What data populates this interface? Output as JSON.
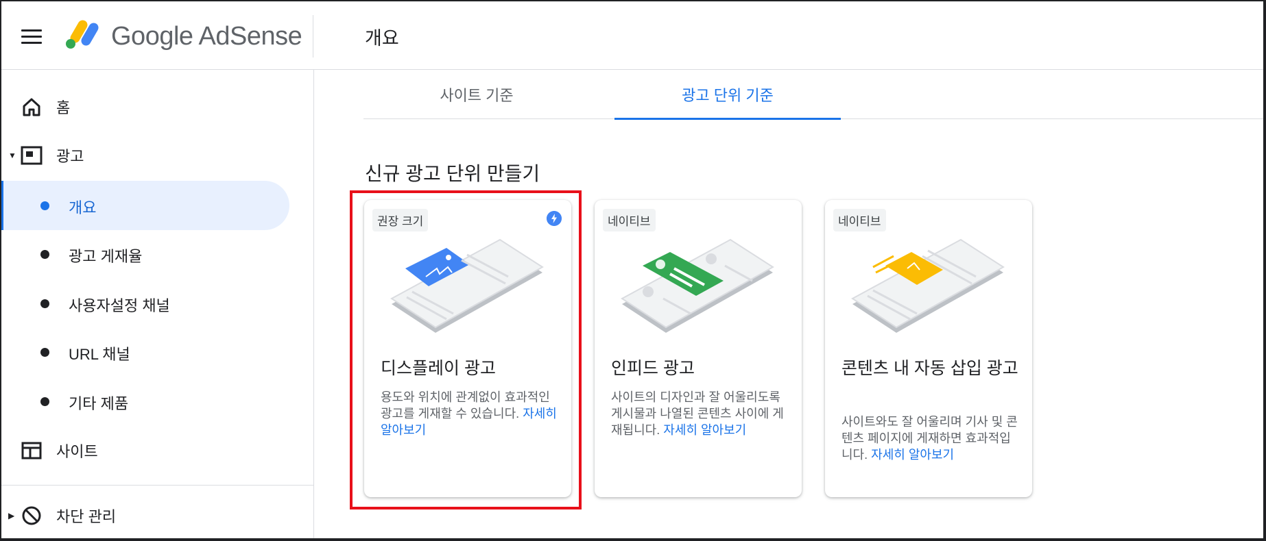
{
  "app": {
    "logo_text": "Google AdSense",
    "page_title": "개요"
  },
  "sidebar": {
    "items": [
      {
        "label": "홈",
        "icon": "home-icon"
      },
      {
        "label": "광고",
        "icon": "ad-unit-icon",
        "expanded": true
      },
      {
        "label": "사이트",
        "icon": "sites-icon"
      },
      {
        "label": "차단 관리",
        "icon": "block-icon",
        "expanded": false
      }
    ],
    "ads_subitems": [
      {
        "label": "개요",
        "active": true
      },
      {
        "label": "광고 게재율",
        "active": false
      },
      {
        "label": "사용자설정 채널",
        "active": false
      },
      {
        "label": "URL 채널",
        "active": false
      },
      {
        "label": "기타 제품",
        "active": false
      }
    ]
  },
  "tabs": [
    {
      "label": "사이트 기준",
      "selected": false
    },
    {
      "label": "광고 단위 기준",
      "selected": true
    }
  ],
  "section_title": "신규 광고 단위 만들기",
  "cards": [
    {
      "chip": "권장 크기",
      "badge_icon": "bolt-icon",
      "title": "디스플레이 광고",
      "description": "용도와 위치에 관계없이 효과적인 광고를 게재할 수 있습니다.",
      "link": "자세히 알아보기",
      "accent": "#4285f4"
    },
    {
      "chip": "네이티브",
      "title": "인피드 광고",
      "description": "사이트의 디자인과 잘 어울리도록 게시물과 나열된 콘텐츠 사이에 게재됩니다.",
      "link": "자세히 알아보기",
      "accent": "#34a853"
    },
    {
      "chip": "네이티브",
      "title": "콘텐츠 내 자동 삽입 광고",
      "description": "사이트와도 잘 어울리며 기사 및 콘텐츠 페이지에 게재하면 효과적입니다.",
      "link": "자세히 알아보기",
      "accent": "#fbbc04"
    }
  ],
  "colors": {
    "brand_blue": "#1a73e8",
    "highlight_red": "#e8101a"
  }
}
